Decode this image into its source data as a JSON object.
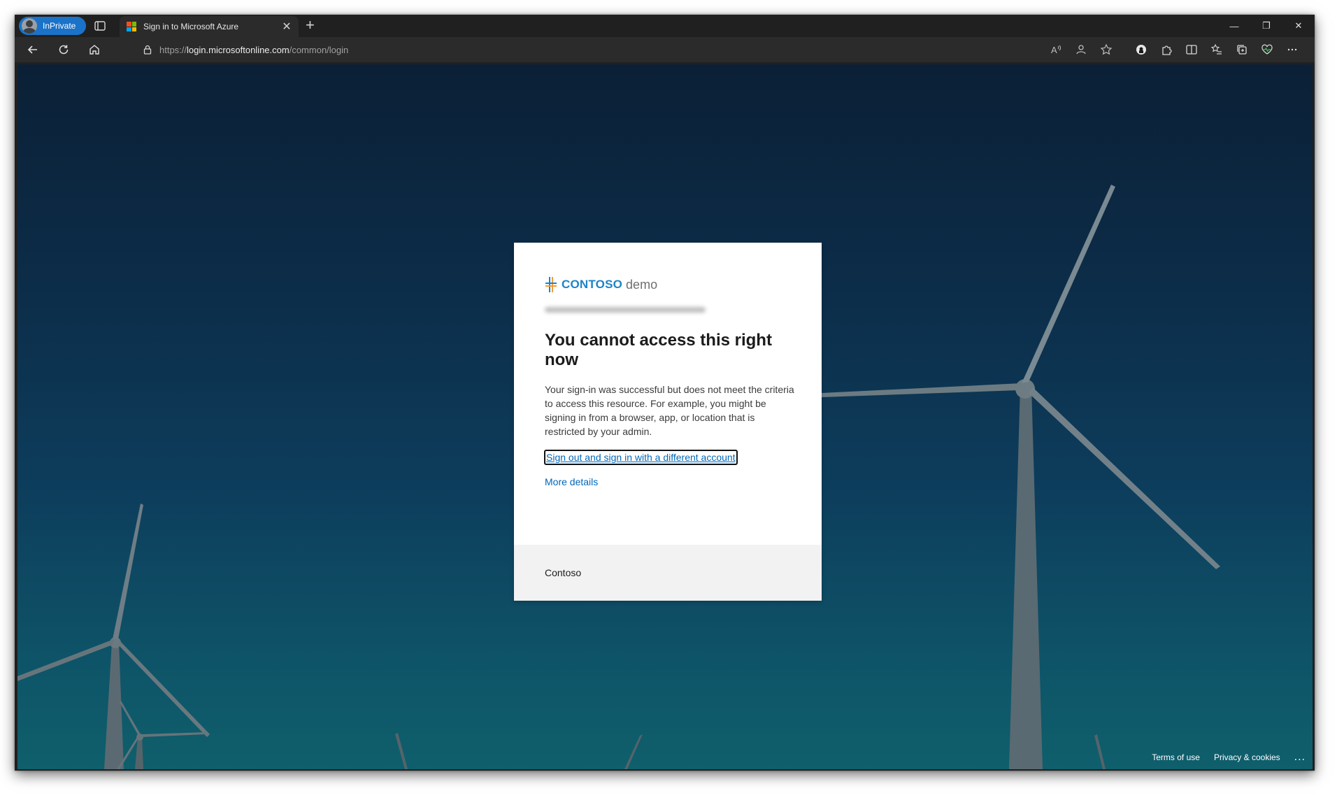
{
  "browser": {
    "profile_label": "InPrivate",
    "tab_title": "Sign in to Microsoft Azure",
    "tab_close": "✕",
    "new_tab": "+",
    "url_scheme": "https://",
    "url_host": "login.microsoftonline.com",
    "url_path": "/common/login",
    "window_controls": {
      "minimize": "—",
      "restore": "❐",
      "close": "✕"
    }
  },
  "card": {
    "brand_primary": "CONTOSO",
    "brand_secondary": "demo",
    "heading": "You cannot access this right now",
    "description": "Your sign-in was successful but does not meet the criteria to access this resource. For example, you might be signing in from a browser, app, or location that is restricted by your admin.",
    "sign_out_link": "Sign out and sign in with a different account",
    "more_details_link": "More details",
    "footer_org": "Contoso"
  },
  "page_footer": {
    "terms": "Terms of use",
    "privacy": "Privacy & cookies",
    "more": "..."
  },
  "colors": {
    "link": "#0067b8",
    "brand": "#1b84c7",
    "inprivate_badge": "#1a73c8"
  }
}
